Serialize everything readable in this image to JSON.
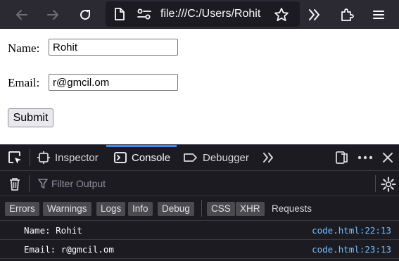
{
  "browser": {
    "url": "file:///C:/Users/Rohit"
  },
  "form": {
    "name_label": "Name:",
    "name_value": "Rohit",
    "email_label": "Email:",
    "email_value": "r@gmcil.om",
    "submit_label": "Submit"
  },
  "devtools": {
    "tabs": [
      {
        "label": "Inspector",
        "icon": "inspector-icon"
      },
      {
        "label": "Console",
        "icon": "console-icon",
        "active": true
      },
      {
        "label": "Debugger",
        "icon": "debugger-icon"
      }
    ],
    "filter_placeholder": "Filter Output",
    "categories": [
      "Errors",
      "Warnings",
      "Logs",
      "Info",
      "Debug",
      "CSS",
      "XHR",
      "Requests"
    ],
    "logs": [
      {
        "message": "Name: Rohit",
        "source": "code.html:22:13"
      },
      {
        "message": "Email: r@gmcil.om",
        "source": "code.html:23:13"
      }
    ],
    "colors": {
      "accent": "#3a8ee6",
      "link": "#75bfff"
    }
  }
}
